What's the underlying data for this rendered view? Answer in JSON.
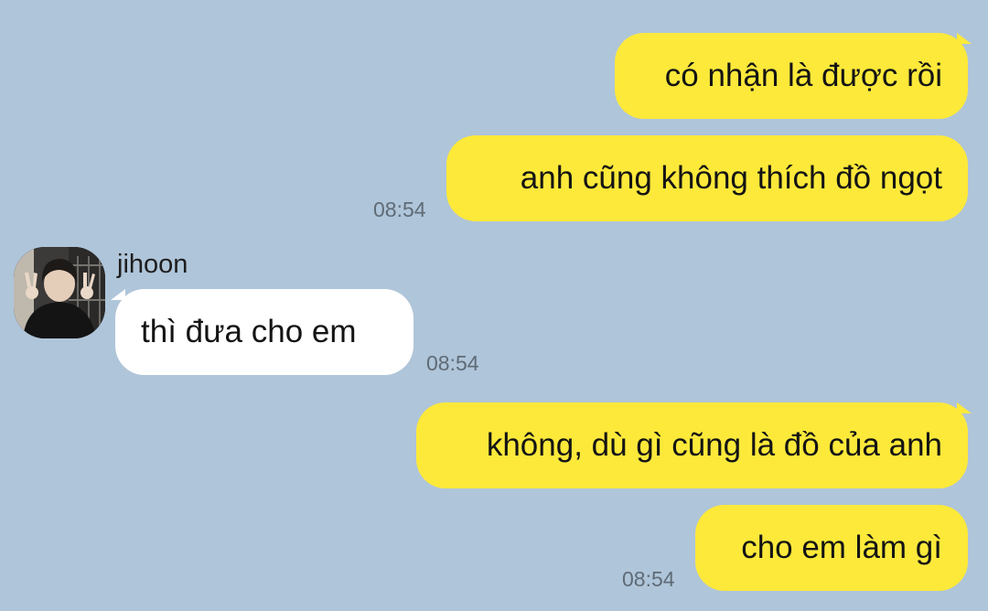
{
  "conversation": {
    "contact_name": "jihoon",
    "messages": [
      {
        "direction": "outgoing",
        "text": "có nhận là được rồi",
        "time": ""
      },
      {
        "direction": "outgoing",
        "text": "anh cũng không thích đồ ngọt",
        "time": "08:54"
      },
      {
        "direction": "incoming",
        "text": "thì đưa cho em",
        "time": "08:54"
      },
      {
        "direction": "outgoing",
        "text": "không, dù gì cũng là đồ của anh",
        "time": ""
      },
      {
        "direction": "outgoing",
        "text": "cho em làm gì",
        "time": "08:54"
      }
    ]
  },
  "colors": {
    "background": "#afc5d9",
    "outgoing_bubble": "#fde93a",
    "incoming_bubble": "#ffffff"
  },
  "icons": {
    "avatar": "contact-photo"
  }
}
